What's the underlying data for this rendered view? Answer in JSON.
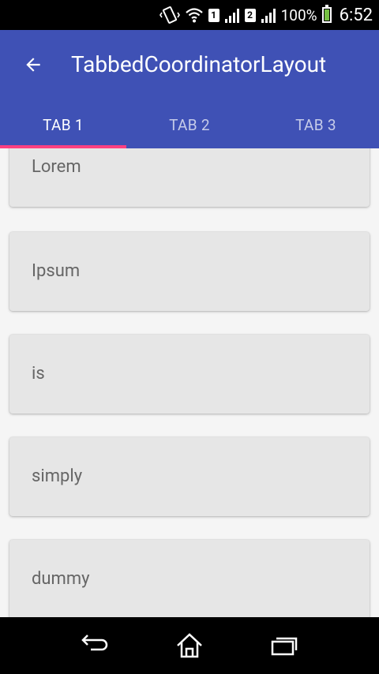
{
  "status_bar": {
    "sim1": "1",
    "sim2": "2",
    "battery_text": "100%",
    "time": "6:52",
    "icons": [
      "vibrate-icon",
      "wifi-icon",
      "signal-icon",
      "signal-icon",
      "battery-icon"
    ]
  },
  "app_bar": {
    "title": "TabbedCoordinatorLayout",
    "background": "#3f51b5"
  },
  "tabs": [
    {
      "label": "TAB 1",
      "selected": true
    },
    {
      "label": "TAB 2",
      "selected": false
    },
    {
      "label": "TAB 3",
      "selected": false
    }
  ],
  "indicator_color": "#ff4081",
  "list": {
    "items": [
      "Lorem",
      "Ipsum",
      "is",
      "simply",
      "dummy"
    ]
  },
  "nav_bar": {
    "icons": [
      "back-icon",
      "home-icon",
      "recents-icon"
    ]
  }
}
